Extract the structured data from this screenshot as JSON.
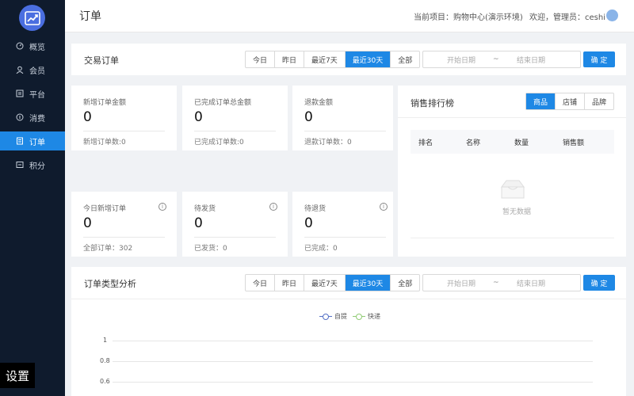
{
  "sidebar": {
    "items": [
      {
        "label": "概览",
        "icon": "dashboard-icon"
      },
      {
        "label": "会员",
        "icon": "user-icon"
      },
      {
        "label": "平台",
        "icon": "platform-icon"
      },
      {
        "label": "消费",
        "icon": "consume-icon"
      },
      {
        "label": "订单",
        "icon": "order-icon",
        "active": true
      },
      {
        "label": "积分",
        "icon": "points-icon"
      }
    ],
    "settings_label": "设置"
  },
  "header": {
    "title": "订单",
    "project": "当前项目：购物中心(演示环境)",
    "welcome": "欢迎，管理员：ceshi"
  },
  "trade": {
    "title": "交易订单",
    "ranges": [
      "今日",
      "昨日",
      "最近7天",
      "最近30天",
      "全部"
    ],
    "active_range": "最近30天",
    "date_start_placeholder": "开始日期",
    "date_sep": "~",
    "date_end_placeholder": "结束日期",
    "confirm": "确 定"
  },
  "stats": [
    {
      "label": "新增订单金额",
      "value": "0",
      "sub": "新增订单数:0"
    },
    {
      "label": "已完成订单总金额",
      "value": "0",
      "sub": "已完成订单数:0"
    },
    {
      "label": "退款金额",
      "value": "0",
      "sub": "退款订单数：0"
    },
    {
      "label": "今日新增订单",
      "value": "0",
      "sub": "全部订单：302",
      "info": true
    },
    {
      "label": "待发货",
      "value": "0",
      "sub": "已发货：0",
      "info": true
    },
    {
      "label": "待退货",
      "value": "0",
      "sub": "已完成：0",
      "info": true
    }
  ],
  "ranking": {
    "title": "销售排行榜",
    "tabs": [
      "商品",
      "店铺",
      "品牌"
    ],
    "active_tab": "商品",
    "columns": [
      "排名",
      "名称",
      "数量",
      "销售额"
    ],
    "empty": "暂无数据"
  },
  "analysis": {
    "title": "订单类型分析",
    "ranges": [
      "今日",
      "昨日",
      "最近7天",
      "最近30天",
      "全部"
    ],
    "active_range": "最近30天",
    "date_start_placeholder": "开始日期",
    "date_sep": "~",
    "date_end_placeholder": "结束日期",
    "confirm": "确 定",
    "legend": [
      {
        "name": "自提",
        "color": "#5470c6"
      },
      {
        "name": "快递",
        "color": "#91cc75"
      }
    ],
    "yticks": [
      "1",
      "0.8",
      "0.6"
    ]
  },
  "colors": {
    "accent": "#1e88e5",
    "sidebar": "#0f1b2d"
  }
}
